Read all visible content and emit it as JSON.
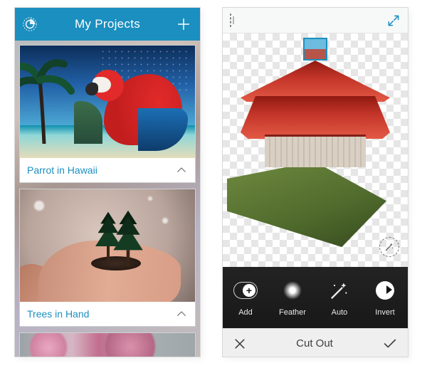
{
  "left": {
    "header_title": "My Projects",
    "projects": [
      {
        "title": "Parrot in Hawaii"
      },
      {
        "title": "Trees in Hand"
      }
    ]
  },
  "right": {
    "tools": {
      "add": "Add",
      "feather": "Feather",
      "auto": "Auto",
      "invert": "Invert"
    },
    "mode_title": "Cut Out"
  }
}
